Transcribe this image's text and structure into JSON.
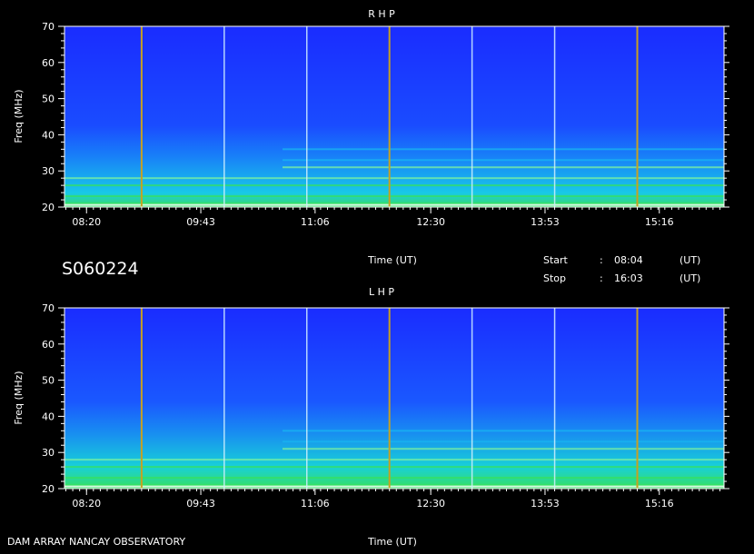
{
  "chart_data": [
    {
      "type": "heatmap",
      "title": "R H P",
      "ylabel": "Freq (MHz)",
      "xlabel": "Time (UT)",
      "ylim": [
        20,
        70
      ],
      "xlim": [
        "08:04",
        "16:03"
      ],
      "y_ticks": [
        "20",
        "30",
        "40",
        "50",
        "60",
        "70"
      ],
      "x_ticks": [
        "08:20",
        "09:43",
        "11:06",
        "12:30",
        "13:53",
        "15:16"
      ],
      "hour_markers_orange": [
        "09:00",
        "12:00",
        "15:00"
      ],
      "hour_markers_white": [
        "10:00",
        "11:00",
        "13:00",
        "14:00"
      ],
      "emission_bands_mhz": [
        21,
        23,
        26,
        28,
        31,
        33,
        36
      ]
    },
    {
      "type": "heatmap",
      "title": "L H P",
      "ylabel": "Freq (MHz)",
      "xlabel": "Time (UT)",
      "ylim": [
        20,
        70
      ],
      "xlim": [
        "08:04",
        "16:03"
      ],
      "y_ticks": [
        "20",
        "30",
        "40",
        "50",
        "60",
        "70"
      ],
      "x_ticks": [
        "08:20",
        "09:43",
        "11:06",
        "12:30",
        "13:53",
        "15:16"
      ],
      "hour_markers_orange": [
        "09:00",
        "12:00",
        "15:00"
      ],
      "hour_markers_white": [
        "10:00",
        "11:00",
        "13:00",
        "14:00"
      ],
      "emission_bands_mhz": [
        21,
        23,
        26,
        28,
        31,
        33,
        36
      ]
    }
  ],
  "info": {
    "id": "S060224",
    "start_label": "Start",
    "start_sep": ":",
    "start_time": "08:04",
    "stop_label": "Stop",
    "stop_sep": ":",
    "stop_time": "16:03",
    "unit": "(UT)",
    "middle_time_label": "Time (UT)"
  },
  "footer": {
    "credit": "DAM ARRAY  NANCAY OBSERVATORY",
    "time_label": "Time (UT)"
  },
  "colors": {
    "background": "#000000",
    "spectrum_low": "#1a2cff",
    "spectrum_mid": "#18b4f0",
    "spectrum_high": "#36e060",
    "hot_pixel": "#ff4040",
    "marker_orange": "#c8a020",
    "marker_white": "#d0f0ff"
  }
}
